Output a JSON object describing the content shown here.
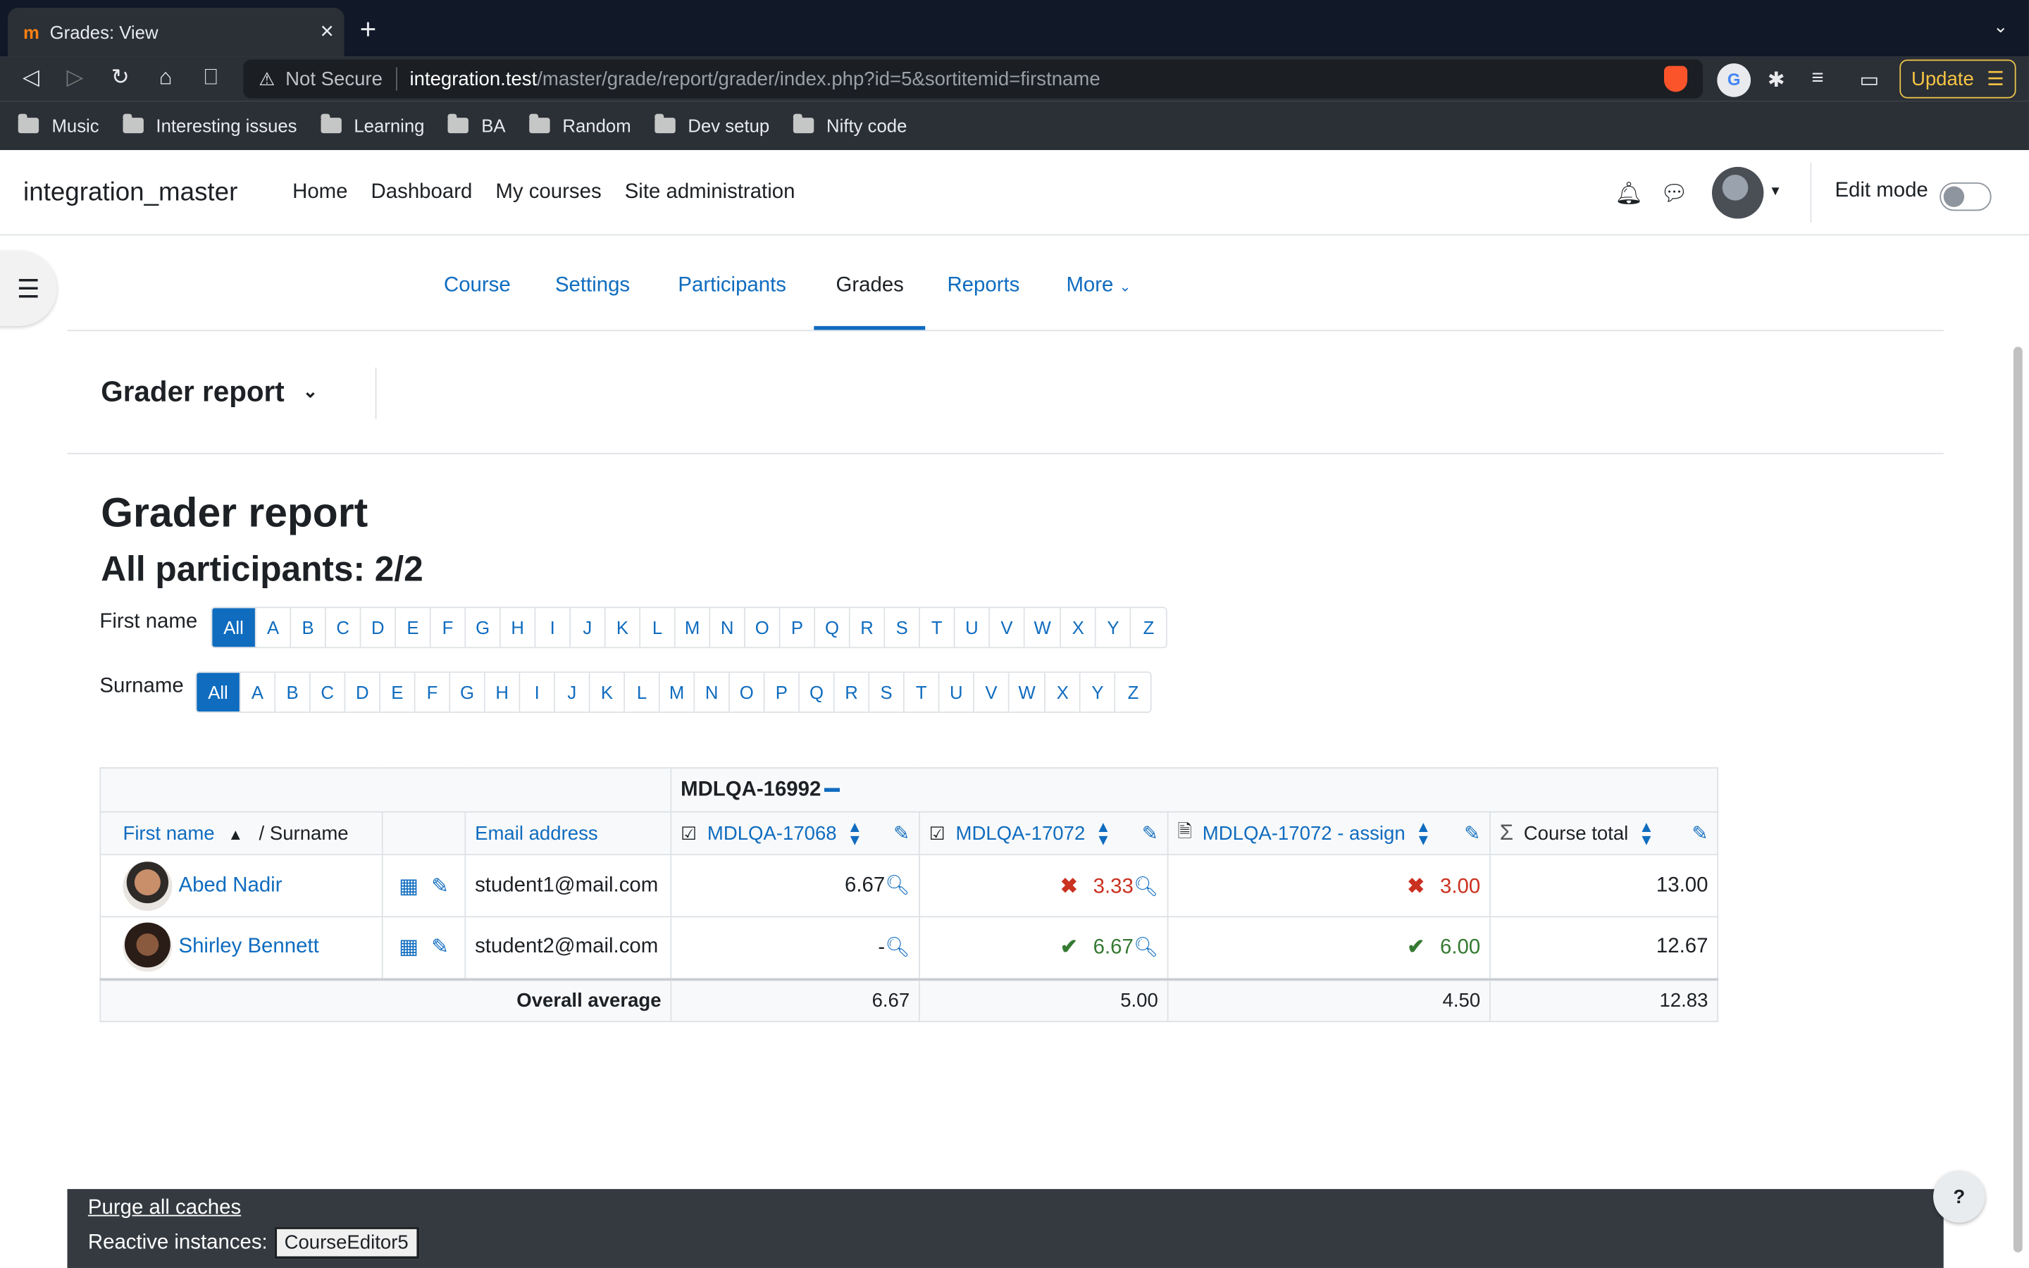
{
  "browser": {
    "tab_title": "Grades: View",
    "not_secure": "Not Secure",
    "url_host": "integration.test",
    "url_path": "/master/grade/report/grader/index.php?id=5&sortitemid=firstname",
    "update_label": "Update",
    "bookmarks": [
      "Music",
      "Interesting issues",
      "Learning",
      "BA",
      "Random",
      "Dev setup",
      "Nifty code"
    ]
  },
  "site": {
    "name": "integration_master",
    "nav": [
      "Home",
      "Dashboard",
      "My courses",
      "Site administration"
    ],
    "edit_mode_label": "Edit mode",
    "edit_mode_on": false
  },
  "secondary_nav": {
    "items": [
      "Course",
      "Settings",
      "Participants",
      "Grades",
      "Reports",
      "More"
    ],
    "active": "Grades"
  },
  "tertiary": {
    "selector_label": "Grader report"
  },
  "report": {
    "heading": "Grader report",
    "subheading": "All participants: 2/2",
    "firstname_label": "First name",
    "surname_label": "Surname",
    "initials_all": "All",
    "letters": [
      "A",
      "B",
      "C",
      "D",
      "E",
      "F",
      "G",
      "H",
      "I",
      "J",
      "K",
      "L",
      "M",
      "N",
      "O",
      "P",
      "Q",
      "R",
      "S",
      "T",
      "U",
      "V",
      "W",
      "X",
      "Y",
      "Z"
    ]
  },
  "table": {
    "category": "MDLQA-16992",
    "col_firstname": "First name",
    "col_surname": "/ Surname",
    "col_email": "Email address",
    "items": [
      "MDLQA-17068",
      "MDLQA-17072",
      "MDLQA-17072 - assign",
      "Course total"
    ],
    "rows": [
      {
        "name": "Abed Nadir",
        "email": "student1@mail.com",
        "g1": "6.67",
        "g2": "3.33",
        "g3": "3.00",
        "total": "13.00"
      },
      {
        "name": "Shirley Bennett",
        "email": "student2@mail.com",
        "g1": "-",
        "g2": "6.67",
        "g3": "6.00",
        "total": "12.67"
      }
    ],
    "avg_label": "Overall average",
    "avg": [
      "6.67",
      "5.00",
      "4.50",
      "12.83"
    ]
  },
  "footer": {
    "purge": "Purge all caches",
    "reactive_label": "Reactive instances:",
    "reactive_value": "CourseEditor5"
  },
  "help_label": "?"
}
